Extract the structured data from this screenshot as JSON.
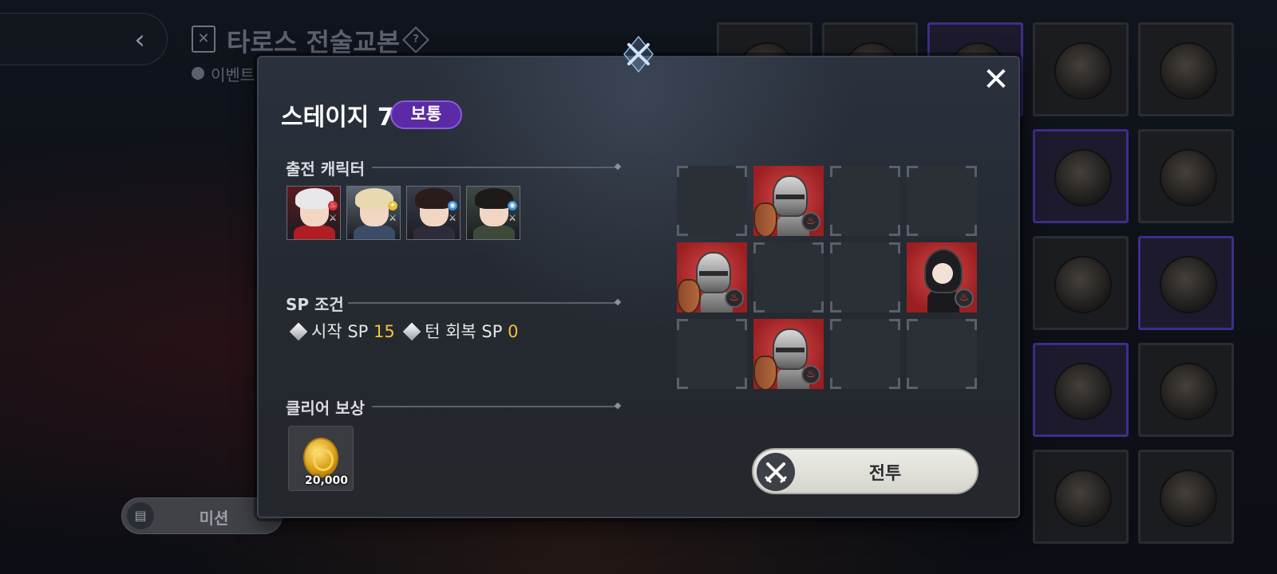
{
  "background": {
    "title": "타로스 전술교본",
    "subtitle": "이벤트",
    "help_glyph": "?",
    "back_glyph": "‹",
    "mission_label": "미션"
  },
  "modal": {
    "stage_title": "스테이지 7",
    "difficulty": "보통",
    "close_glyph": "✕",
    "sections": {
      "characters": "출전 캐릭터",
      "sp": "SP 조건",
      "reward": "클리어 보상"
    },
    "characters": [
      {
        "name": "character-1",
        "element": "fire",
        "element_color": "#d8323a",
        "hair": "#e8e8ec",
        "outfit": "#b01e24",
        "bg": "#5a1a1e"
      },
      {
        "name": "character-2",
        "element": "light",
        "element_color": "#e6c23a",
        "hair": "#e8d9b0",
        "outfit": "#3b4c68",
        "bg": "#5d6674"
      },
      {
        "name": "character-3",
        "element": "water",
        "element_color": "#3a8fe0",
        "hair": "#2a1c1a",
        "outfit": "#2c2c3a",
        "bg": "#3b3c4c"
      },
      {
        "name": "character-4",
        "element": "water",
        "element_color": "#3a8fe0",
        "hair": "#1e1a18",
        "outfit": "#3d4a3a",
        "bg": "#3e4a44"
      }
    ],
    "sp": {
      "start_label": "시작 SP",
      "start_value": "15",
      "turn_label": "턴 회복 SP",
      "turn_value": "0"
    },
    "reward": {
      "item": "gold-coin",
      "count": "20,000"
    },
    "formation": {
      "rows": 3,
      "cols": 4,
      "enemies": [
        {
          "row": 0,
          "col": 1,
          "type": "knight",
          "element": "fire"
        },
        {
          "row": 1,
          "col": 0,
          "type": "knight",
          "element": "fire"
        },
        {
          "row": 1,
          "col": 3,
          "type": "witch",
          "element": "fire"
        },
        {
          "row": 2,
          "col": 1,
          "type": "knight",
          "element": "fire"
        }
      ]
    },
    "battle_button": "전투"
  },
  "colors": {
    "difficulty_bg": "#5b2aa6",
    "sp_value": "#f3c338",
    "enemy_bg": "#c03a3c"
  }
}
